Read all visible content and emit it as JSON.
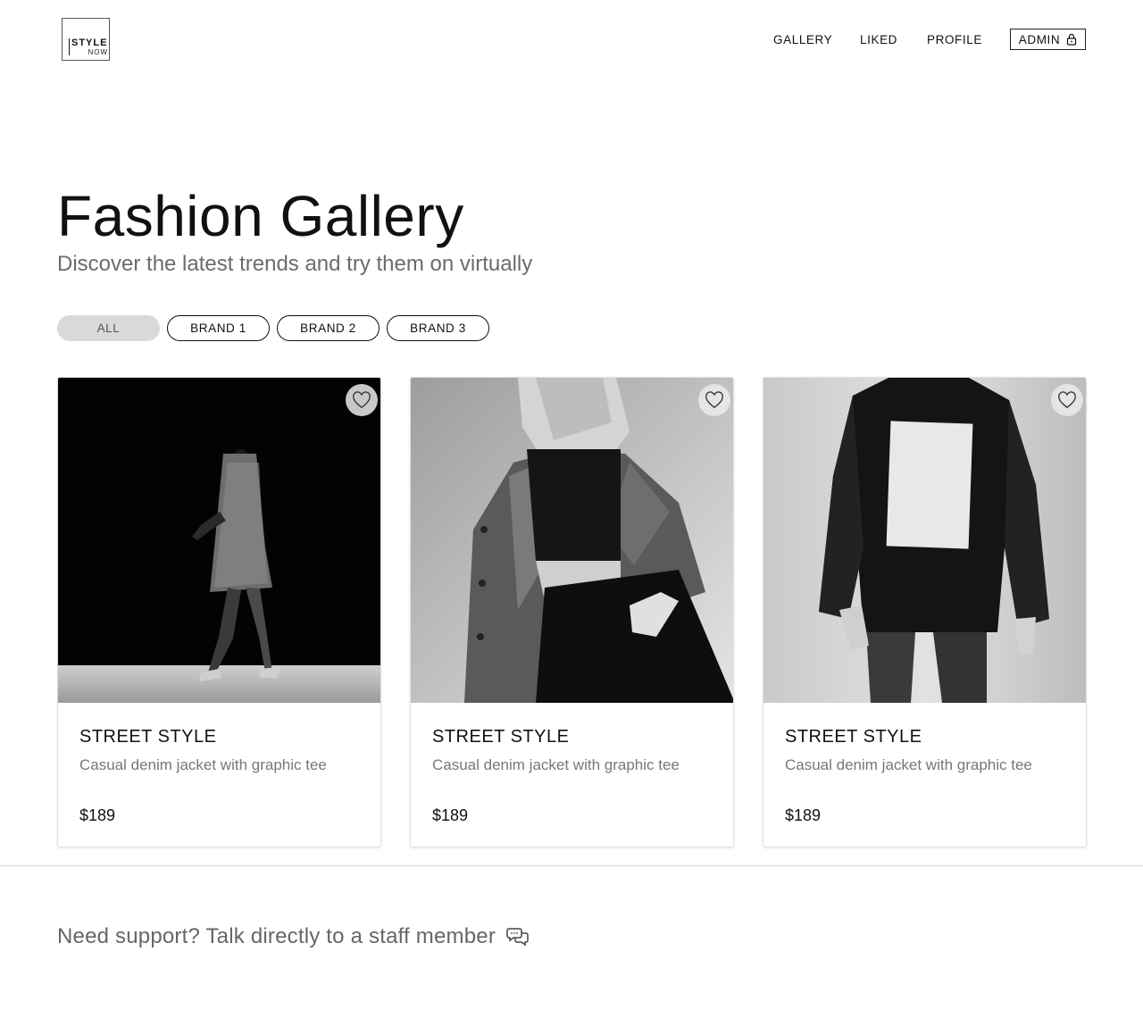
{
  "header": {
    "logo": {
      "line1": "STYLE",
      "line2": "NOW"
    },
    "nav": [
      {
        "label": "GALLERY"
      },
      {
        "label": "LIKED"
      },
      {
        "label": "PROFILE"
      }
    ],
    "admin": {
      "label": "ADMIN",
      "icon": "lock-icon"
    }
  },
  "hero": {
    "title": "Fashion Gallery",
    "subtitle": "Discover the latest trends and try them on virtually"
  },
  "filters": [
    {
      "label": "ALL",
      "active": true
    },
    {
      "label": "BRAND 1",
      "active": false
    },
    {
      "label": "BRAND 2",
      "active": false
    },
    {
      "label": "BRAND 3",
      "active": false
    }
  ],
  "cards": [
    {
      "title": "STREET STYLE",
      "description": "Casual denim jacket with graphic tee",
      "price": "$189",
      "liked": false
    },
    {
      "title": "STREET STYLE",
      "description": "Casual denim jacket with graphic tee",
      "price": "$189",
      "liked": false
    },
    {
      "title": "STREET STYLE",
      "description": "Casual denim jacket with graphic tee",
      "price": "$189",
      "liked": false
    }
  ],
  "footer": {
    "support_text": "Need support? Talk directly to a staff member",
    "support_icon": "chat-bubbles-icon"
  },
  "colors": {
    "text": "#111111",
    "muted": "#6b6b6b",
    "pill_active_bg": "#d9d9d9"
  }
}
